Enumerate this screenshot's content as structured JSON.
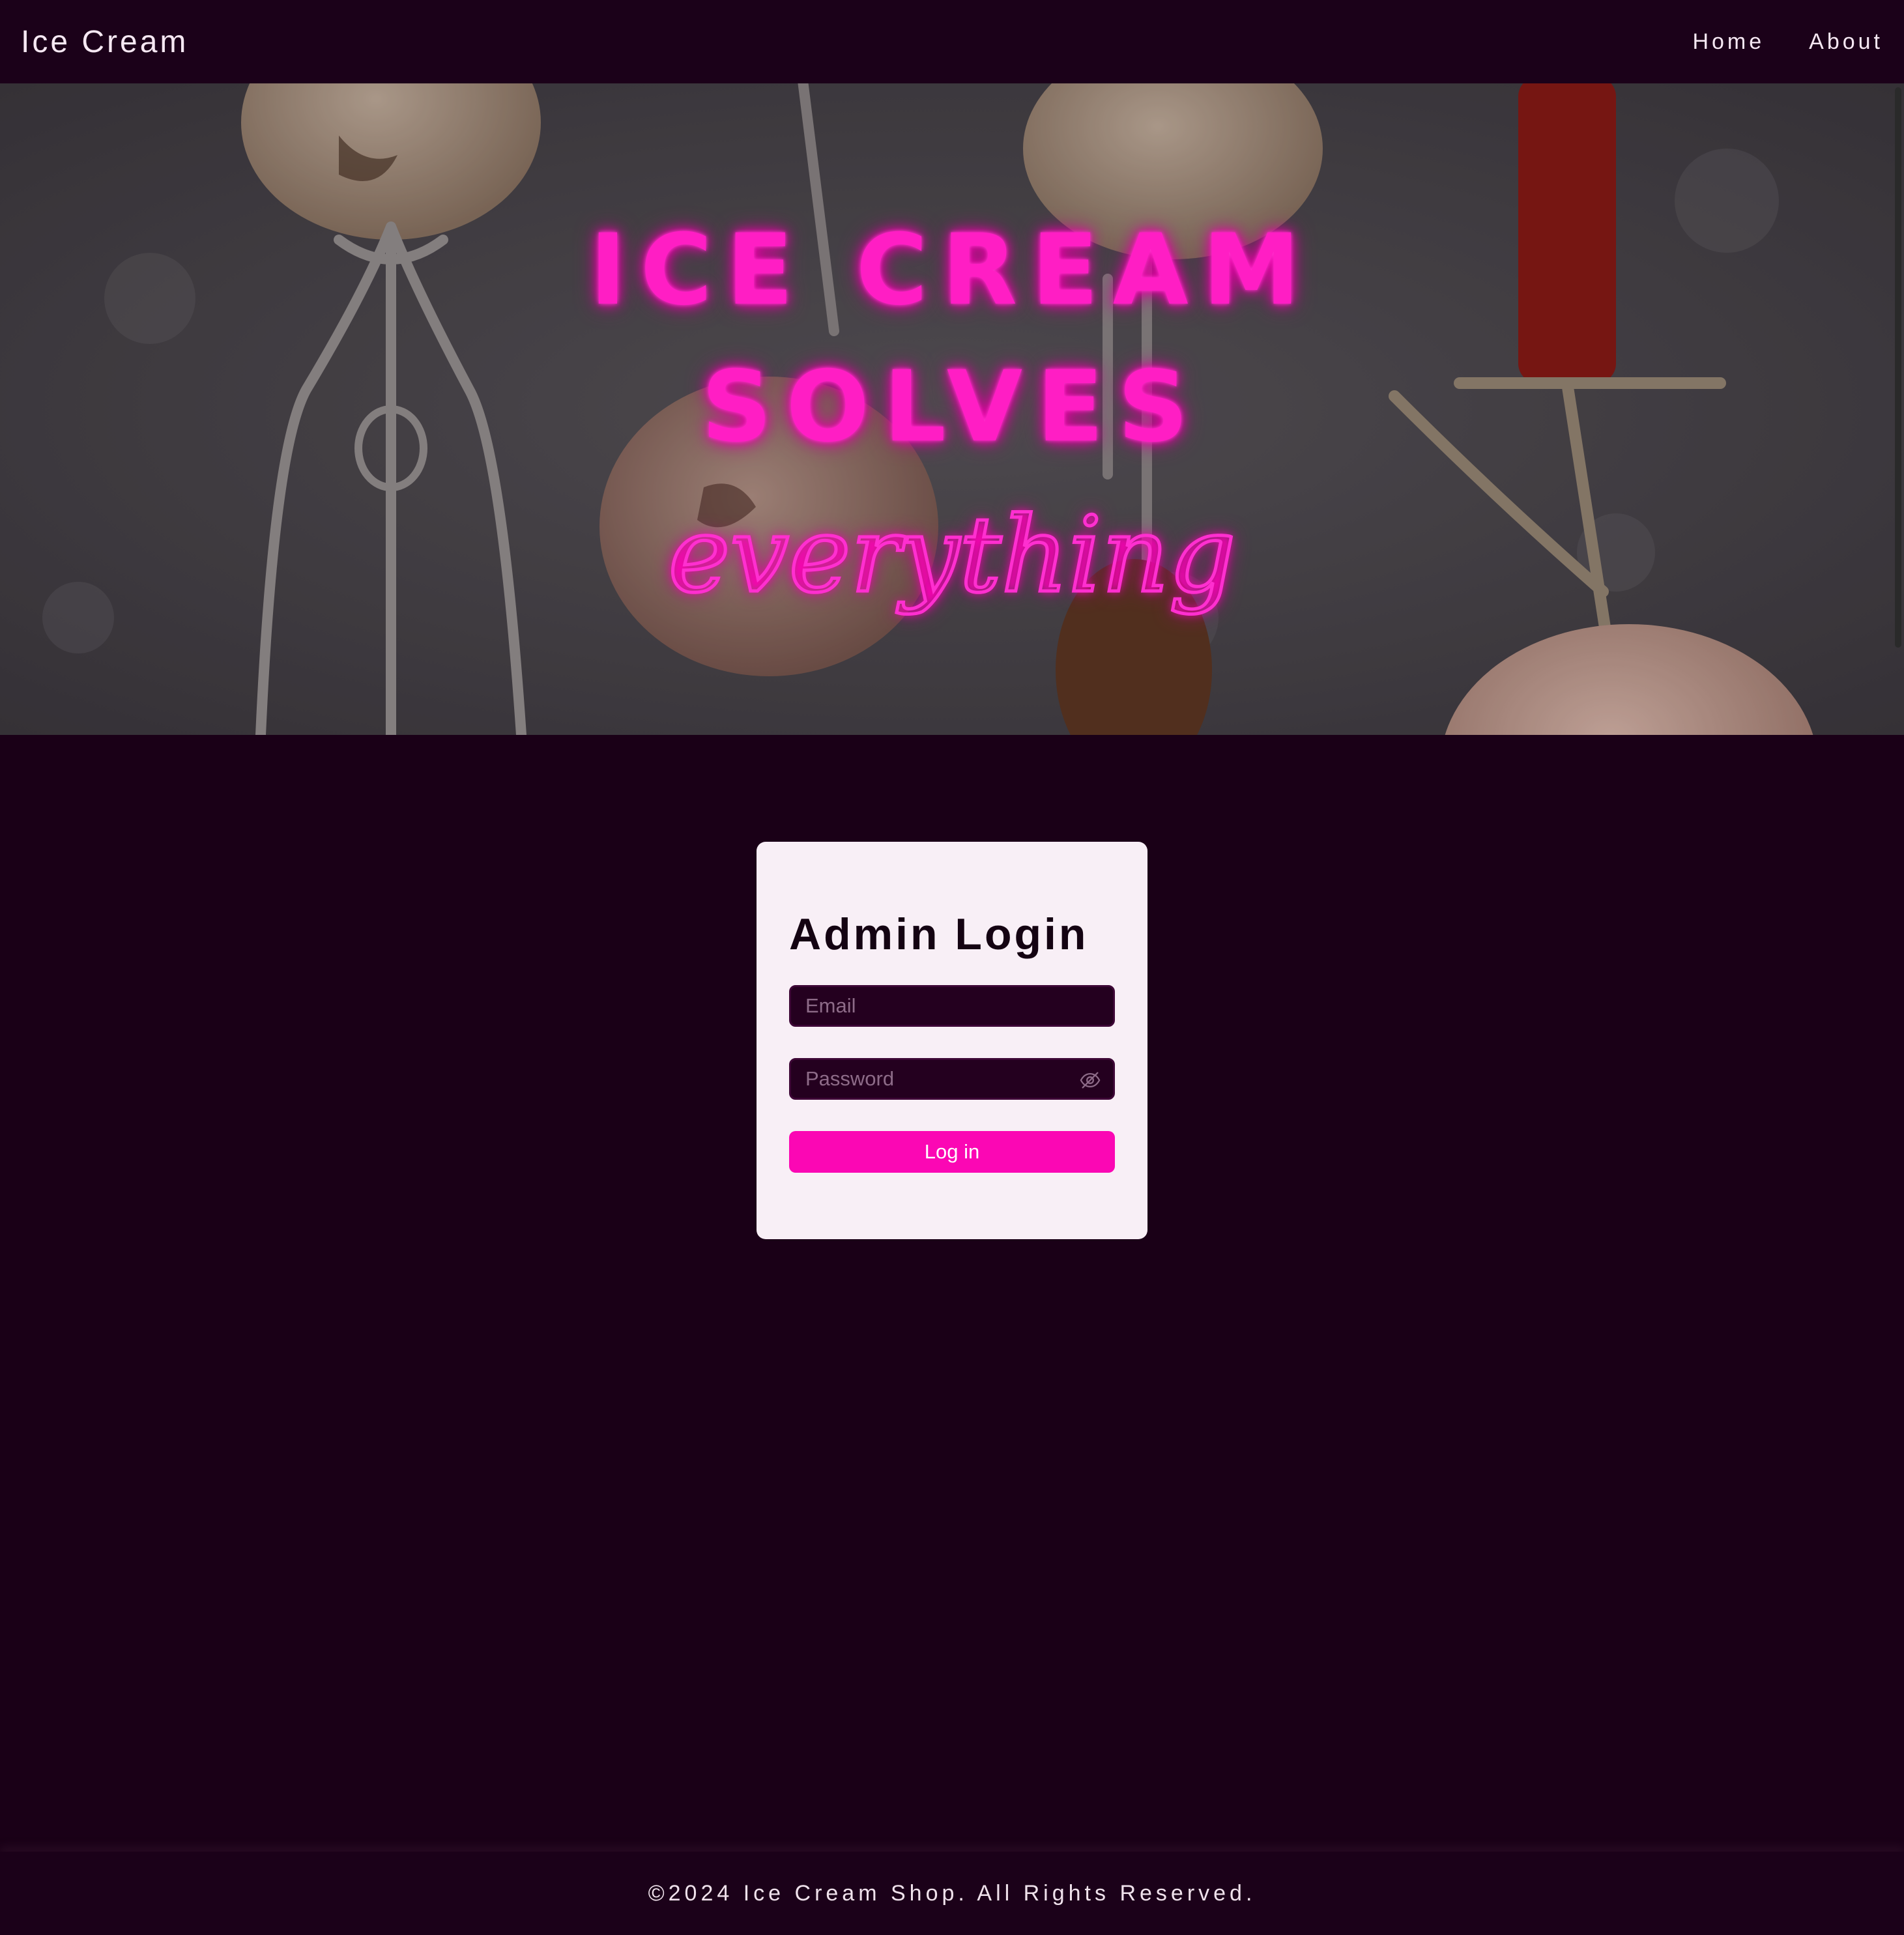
{
  "nav": {
    "brand": "Ice Cream",
    "links": [
      "Home",
      "About"
    ]
  },
  "hero": {
    "line1": "ICE CREAM",
    "line2": "SOLVES",
    "line3": "everything",
    "neon_color": "#ff1ec4"
  },
  "login": {
    "title": "Admin Login",
    "email_placeholder": "Email",
    "password_placeholder": "Password",
    "toggle_icon": "eye-off-icon",
    "button_label": "Log in",
    "button_color": "#fb07b4"
  },
  "footer": {
    "text": "©2024 Ice Cream Shop. All Rights Reserved."
  }
}
